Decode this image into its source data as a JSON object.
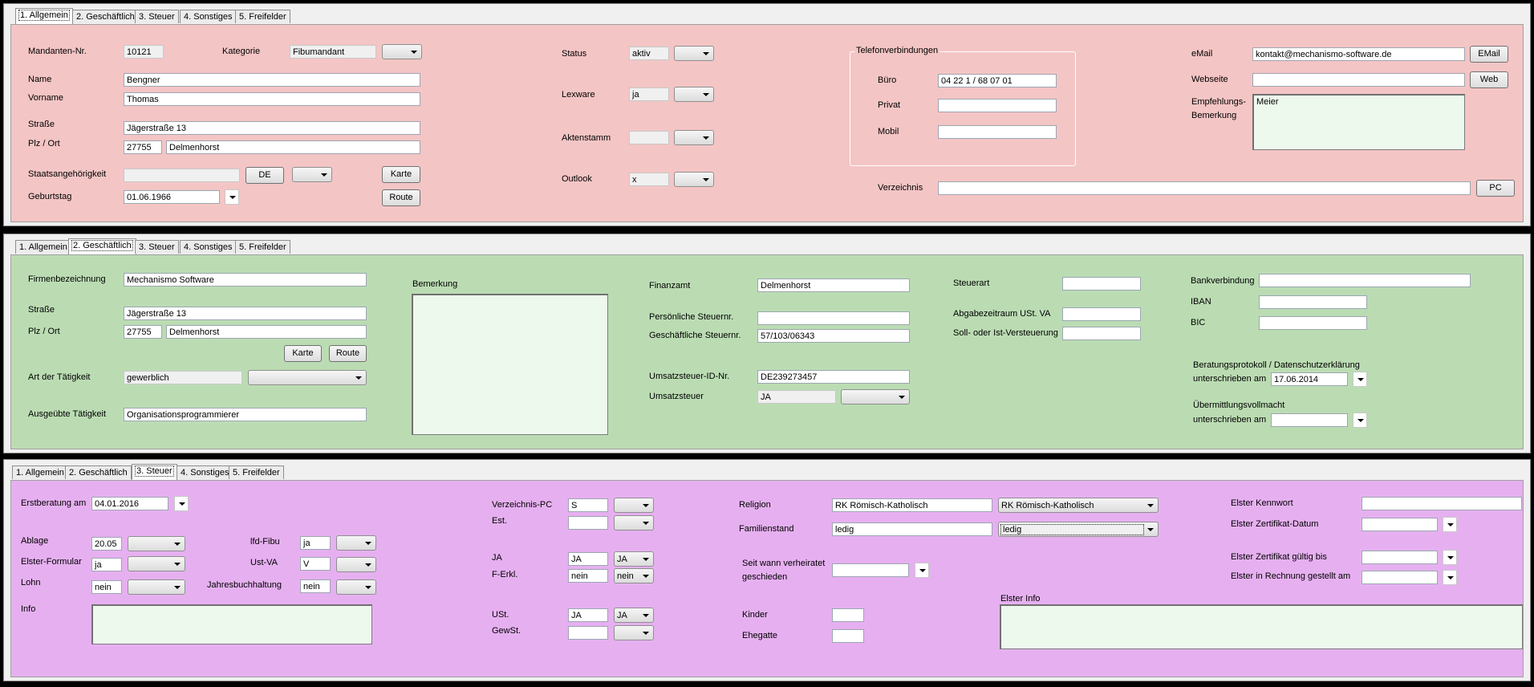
{
  "tabs": [
    "1. Allgemein",
    "2. Geschäftlich",
    "3. Steuer",
    "4. Sonstiges",
    "5. Freifelder"
  ],
  "colors": {
    "allgemein": "#f4c5c5",
    "geschaeftlich": "#bbdcb3",
    "steuer": "#e6b0f0",
    "memo": "#eef9ee"
  },
  "allgemein": {
    "mandanten_nr_label": "Mandanten-Nr.",
    "mandanten_nr": "10121",
    "kategorie_label": "Kategorie",
    "kategorie": "Fibumandant",
    "name_label": "Name",
    "name": "Bengner",
    "vorname_label": "Vorname",
    "vorname": "Thomas",
    "strasse_label": "Straße",
    "strasse": "Jägerstraße 13",
    "plz_ort_label": "Plz / Ort",
    "plz": "27755",
    "ort": "Delmenhorst",
    "staat_label": "Staatsangehörigkeit",
    "staat": "",
    "de_button": "DE",
    "karte_button": "Karte",
    "geburtstag_label": "Geburtstag",
    "geburtstag": "01.06.1966",
    "route_button": "Route",
    "status_label": "Status",
    "status": "aktiv",
    "lexware_label": "Lexware",
    "lexware": "ja",
    "aktenstamm_label": "Aktenstamm",
    "aktenstamm": "",
    "outlook_label": "Outlook",
    "outlook": "x",
    "telefon_group": "Telefonverbindungen",
    "buero_label": "Büro",
    "buero": "04 22 1 / 68 07 01",
    "privat_label": "Privat",
    "privat": "",
    "mobil_label": "Mobil",
    "mobil": "",
    "verzeichnis_label": "Verzeichnis",
    "verzeichnis": "",
    "pc_button": "PC",
    "email_label": "eMail",
    "email": "kontakt@mechanismo-software.de",
    "email_button": "EMail",
    "webseite_label": "Webseite",
    "webseite": "",
    "web_button": "Web",
    "empfehlung_label1": "Empfehlungs-",
    "empfehlung_label2": "Bemerkung",
    "empfehlung": "Meier"
  },
  "geschaeftlich": {
    "firma_label": "Firmenbezeichnung",
    "firma": "Mechanismo Software",
    "strasse_label": "Straße",
    "strasse": "Jägerstraße 13",
    "plz_ort_label": "Plz / Ort",
    "plz": "27755",
    "ort": "Delmenhorst",
    "karte_button": "Karte",
    "route_button": "Route",
    "art_label": "Art der Tätigkeit",
    "art": "gewerblich",
    "ausgeuebt_label": "Ausgeübte Tätigkeit",
    "ausgeuebt": "Organisationsprogrammierer",
    "bemerkung_label": "Bemerkung",
    "bemerkung": "",
    "finanzamt_label": "Finanzamt",
    "finanzamt": "Delmenhorst",
    "pers_steuernr_label": "Persönliche Steuernr.",
    "pers_steuernr": "",
    "gesch_steuernr_label": "Geschäftliche Steuernr.",
    "gesch_steuernr": "57/103/06343",
    "ustid_label": "Umsatzsteuer-ID-Nr.",
    "ustid": "DE239273457",
    "umsatzsteuer_label": "Umsatzsteuer",
    "umsatzsteuer": "JA",
    "steuerart_label": "Steuerart",
    "steuerart": "",
    "abgabe_label": "Abgabezeitraum USt. VA",
    "abgabe": "",
    "soll_ist_label": "Soll- oder Ist-Versteuerung",
    "soll_ist": "",
    "bank_label": "Bankverbindung",
    "bank": "",
    "iban_label": "IBAN",
    "iban": "",
    "bic_label": "BIC",
    "bic": "",
    "beratung_label": "Beratungsprotokoll / Datenschutzerklärung",
    "unterschrieben_label1": "unterschrieben am",
    "unterschrieben1": "17.06.2014",
    "vollmacht_label": "Übermittlungsvollmacht",
    "unterschrieben_label2": "unterschrieben am",
    "unterschrieben2": ""
  },
  "steuer": {
    "erstberatung_label": "Erstberatung am",
    "erstberatung": "04.01.2016",
    "ablage_label": "Ablage",
    "ablage": "20.05",
    "elster_formular_label": "Elster-Formular",
    "elster_formular": "ja",
    "lohn_label": "Lohn",
    "lohn": "nein",
    "lfd_fibu_label": "lfd-Fibu",
    "lfd_fibu": "ja",
    "ust_va_label": "Ust-VA",
    "ust_va": "V",
    "jahresbuch_label": "Jahresbuchhaltung",
    "jahresbuch": "nein",
    "info_label": "Info",
    "info": "",
    "verz_pc_label": "Verzeichnis-PC",
    "verz_pc": "S",
    "est_label": "Est.",
    "est": "",
    "ja_label": "JA",
    "ja": "JA",
    "ja_cb": "JA",
    "ferkl_label": "F-Erkl.",
    "ferkl": "nein",
    "ferkl_cb": "nein",
    "ust_label": "USt.",
    "ust": "JA",
    "ust_cb": "JA",
    "gewst_label": "GewSt.",
    "gewst": "",
    "religion_label": "Religion",
    "religion": "RK Römisch-Katholisch",
    "religion_cb": "RK Römisch-Katholisch",
    "familienstand_label": "Familienstand",
    "familienstand": "ledig",
    "familienstand_cb": "ledig",
    "seit_label1": "Seit wann verheiratet",
    "seit_label2": "geschieden",
    "seit": "",
    "kinder_label": "Kinder",
    "kinder": "",
    "ehegatte_label": "Ehegatte",
    "ehegatte": "",
    "elster_kennwort_label": "Elster Kennwort",
    "elster_kennwort": "",
    "elster_zert_datum_label": "Elster Zertifikat-Datum",
    "elster_zert_datum": "",
    "elster_zert_gueltig_label": "Elster Zertifikat gültig bis",
    "elster_zert_gueltig": "",
    "elster_rechnung_label": "Elster in Rechnung gestellt am",
    "elster_rechnung": "",
    "elster_info_label": "Elster Info",
    "elster_info": ""
  }
}
